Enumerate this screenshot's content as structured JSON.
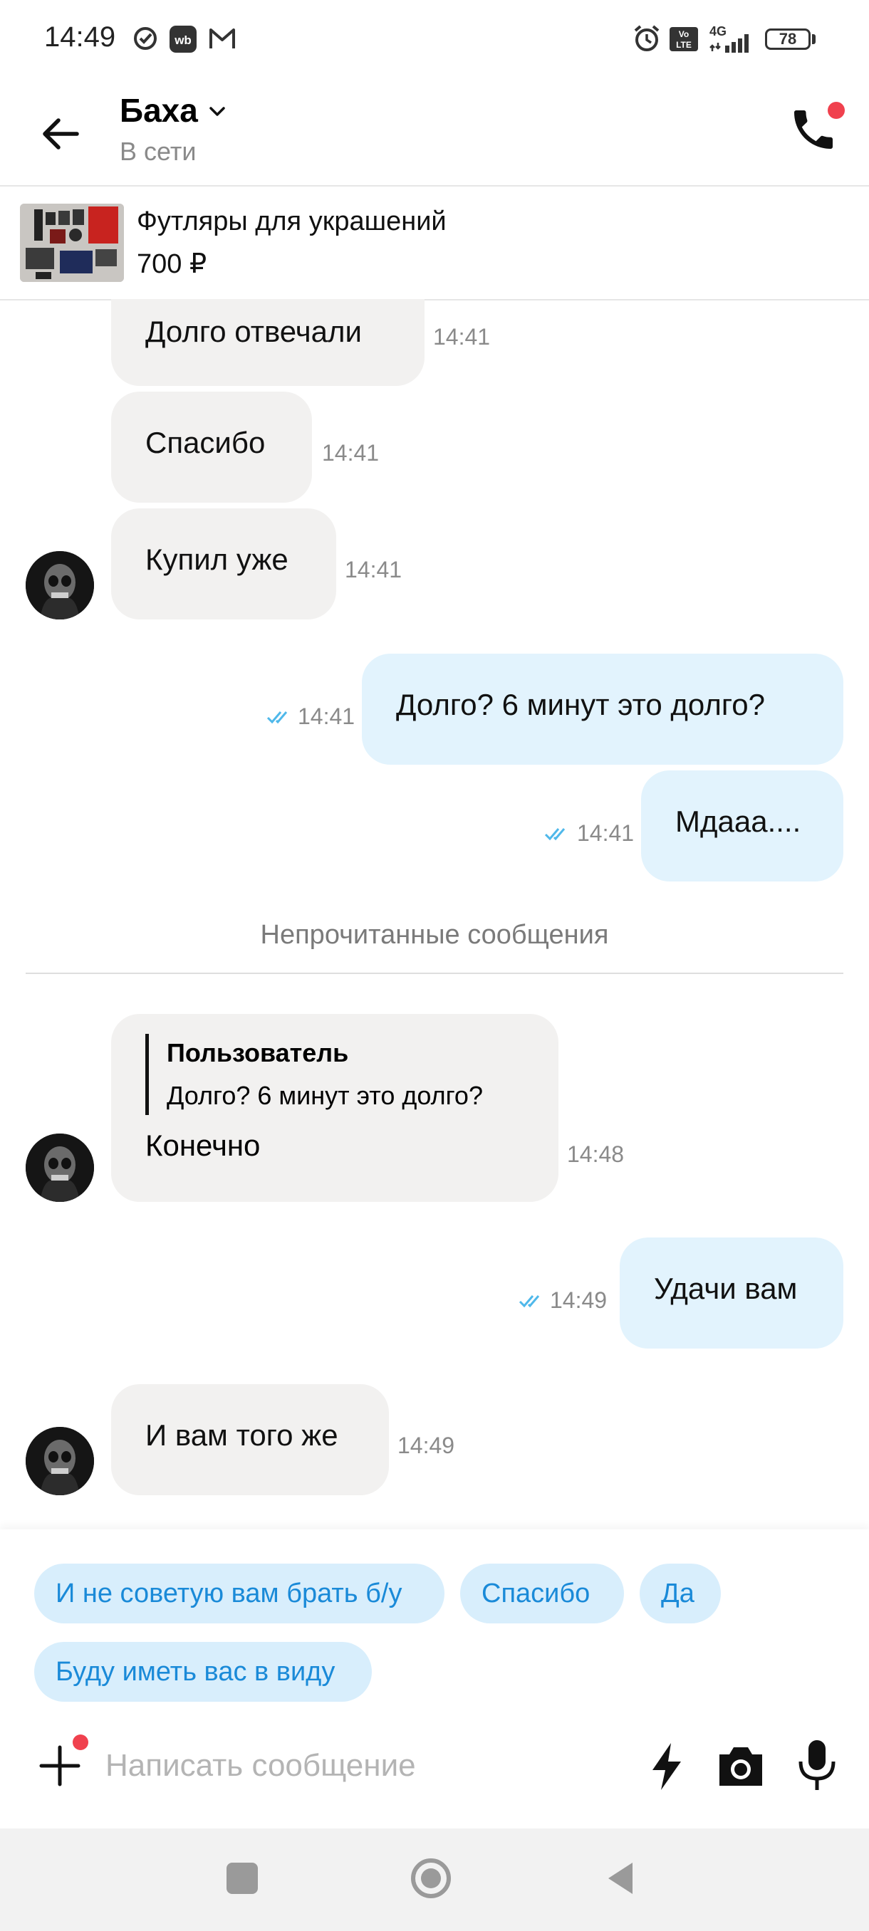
{
  "status_bar": {
    "time": "14:49",
    "battery": "78",
    "network": "4G"
  },
  "header": {
    "contact_name": "Баха",
    "status": "В сети"
  },
  "product": {
    "title": "Футляры для украшений",
    "price": "700 ₽"
  },
  "messages": [
    {
      "direction": "in",
      "text": "Долго отвечали",
      "time": "14:41"
    },
    {
      "direction": "in",
      "text": "Спасибо",
      "time": "14:41"
    },
    {
      "direction": "in",
      "text": "Купил уже",
      "time": "14:41"
    },
    {
      "direction": "out",
      "text": "Долго? 6 минут это долго?",
      "time": "14:41",
      "read": true
    },
    {
      "direction": "out",
      "text": "Мдааа....",
      "time": "14:41",
      "read": true
    },
    {
      "direction": "in",
      "quote_author": "Пользователь",
      "quote_text": "Долго? 6 минут это долго?",
      "text": "Конечно",
      "time": "14:48"
    },
    {
      "direction": "out",
      "text": "Удачи вам",
      "time": "14:49",
      "read": true
    },
    {
      "direction": "in",
      "text": "И вам того же",
      "time": "14:49"
    }
  ],
  "unread_divider": "Непрочитанные сообщения",
  "suggestions": [
    "И не советую вам брать б/у",
    "Спасибо",
    "Да",
    "Буду иметь вас в виду"
  ],
  "input": {
    "placeholder": "Написать сообщение",
    "value": ""
  },
  "colors": {
    "incoming_bubble": "#f2f1f0",
    "outgoing_bubble": "#e2f3fd",
    "chip_bg": "#d8eefc",
    "chip_text": "#1a8ad8",
    "badge": "#f0414e",
    "read_tick": "#4fb8ea"
  }
}
